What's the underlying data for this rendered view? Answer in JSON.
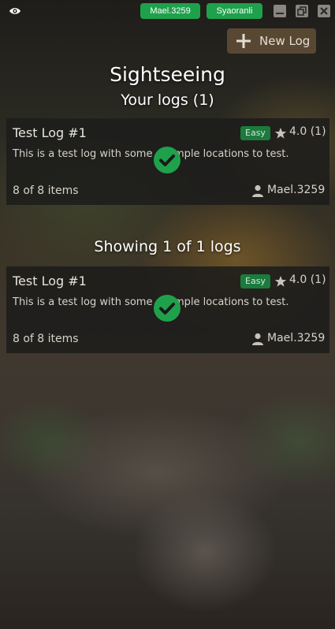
{
  "topbar": {
    "visibility_icon": "eye-icon",
    "accounts": [
      "Mael.3259",
      "Syaoranli"
    ],
    "window_controls": [
      "minimize-icon",
      "restore-icon",
      "close-icon"
    ]
  },
  "toolbar": {
    "new_log_label": "New Log",
    "new_log_icon": "plus-icon"
  },
  "page": {
    "title": "Sightseeing",
    "your_logs_heading": "Your logs (1)",
    "showing_heading": "Showing 1 of 1 logs"
  },
  "your_logs": [
    {
      "name": "Test Log #1",
      "difficulty": "Easy",
      "rating": "4.0 (1)",
      "description": "This is a test log with some example locations to test.",
      "items": "8 of 8 items",
      "author": "Mael.3259",
      "completed": true
    }
  ],
  "all_logs": [
    {
      "name": "Test Log #1",
      "difficulty": "Easy",
      "rating": "4.0 (1)",
      "description": "This is a test log with some example locations to test.",
      "items": "8 of 8 items",
      "author": "Mael.3259",
      "completed": true
    }
  ],
  "colors": {
    "account_pill": "#1fa14c",
    "difficulty_badge": "#1c7a3e",
    "completed_check": "#1fa14c"
  }
}
